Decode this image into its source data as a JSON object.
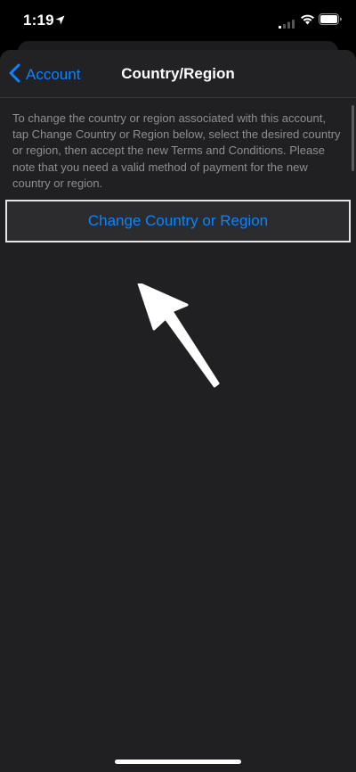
{
  "status_bar": {
    "time": "1:19",
    "icons": [
      "location-arrow-icon",
      "cellular-signal-icon",
      "wifi-icon",
      "battery-icon"
    ]
  },
  "nav": {
    "back_label": "Account",
    "title": "Country/Region"
  },
  "info_text": "To change the country or region associated with this account, tap Change Country or Region below, select the desired country or region, then accept the new Terms and Conditions. Please note that you need a valid method of payment for the new country or region.",
  "action": {
    "label": "Change Country or Region"
  },
  "colors": {
    "accent": "#0a84ff",
    "background": "#000000",
    "sheet": "#202022",
    "secondary_text": "#8e8e93"
  }
}
